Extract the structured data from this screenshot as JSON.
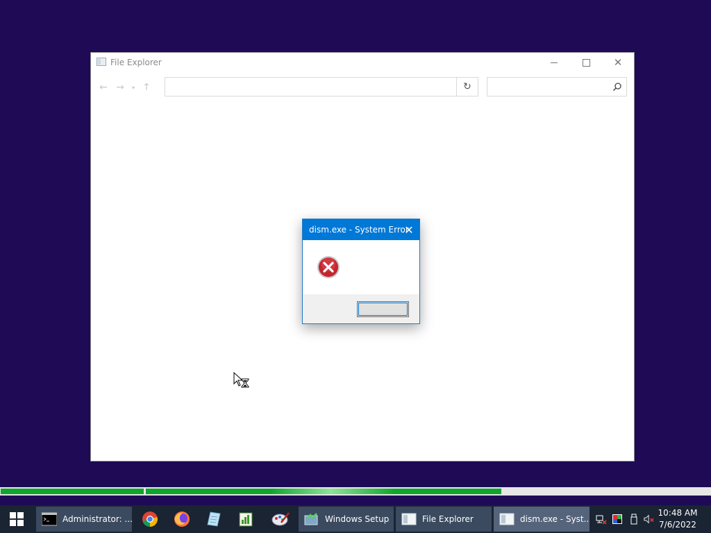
{
  "file_explorer": {
    "title": "File Explorer",
    "address_value": "",
    "search_placeholder": "",
    "icons": {
      "back": "back-arrow-icon",
      "forward": "forward-arrow-icon",
      "recent": "chevron-down-icon",
      "up": "up-arrow-icon",
      "refresh": "refresh-icon",
      "search": "search-icon"
    }
  },
  "dialog": {
    "title": "dism.exe - System Error",
    "message": "",
    "button_label": "",
    "icon": "error-icon"
  },
  "progress": {
    "segments": [
      1.0,
      0.63
    ],
    "color": "#10a52c"
  },
  "taskbar": {
    "items": [
      {
        "label": "Administrator: ...",
        "icon": "console-icon"
      },
      {
        "label": "Windows Setup",
        "icon": "setup-icon"
      },
      {
        "label": "File Explorer",
        "icon": "explorer-icon"
      },
      {
        "label": "dism.exe - Syst...",
        "icon": "explorer-icon"
      }
    ],
    "pinned": [
      "chrome-icon",
      "firefox-icon",
      "notepad-icon",
      "spreadsheet-icon",
      "paint-icon"
    ],
    "tray": [
      "network-icon",
      "color-icon",
      "usb-icon",
      "volume-muted-icon"
    ],
    "clock": {
      "time": "10:48 AM",
      "date": "7/6/2022"
    }
  },
  "colors": {
    "desktop": "#1e0a55",
    "dialog_titlebar": "#0078d7",
    "taskbar": "#1a2433"
  }
}
